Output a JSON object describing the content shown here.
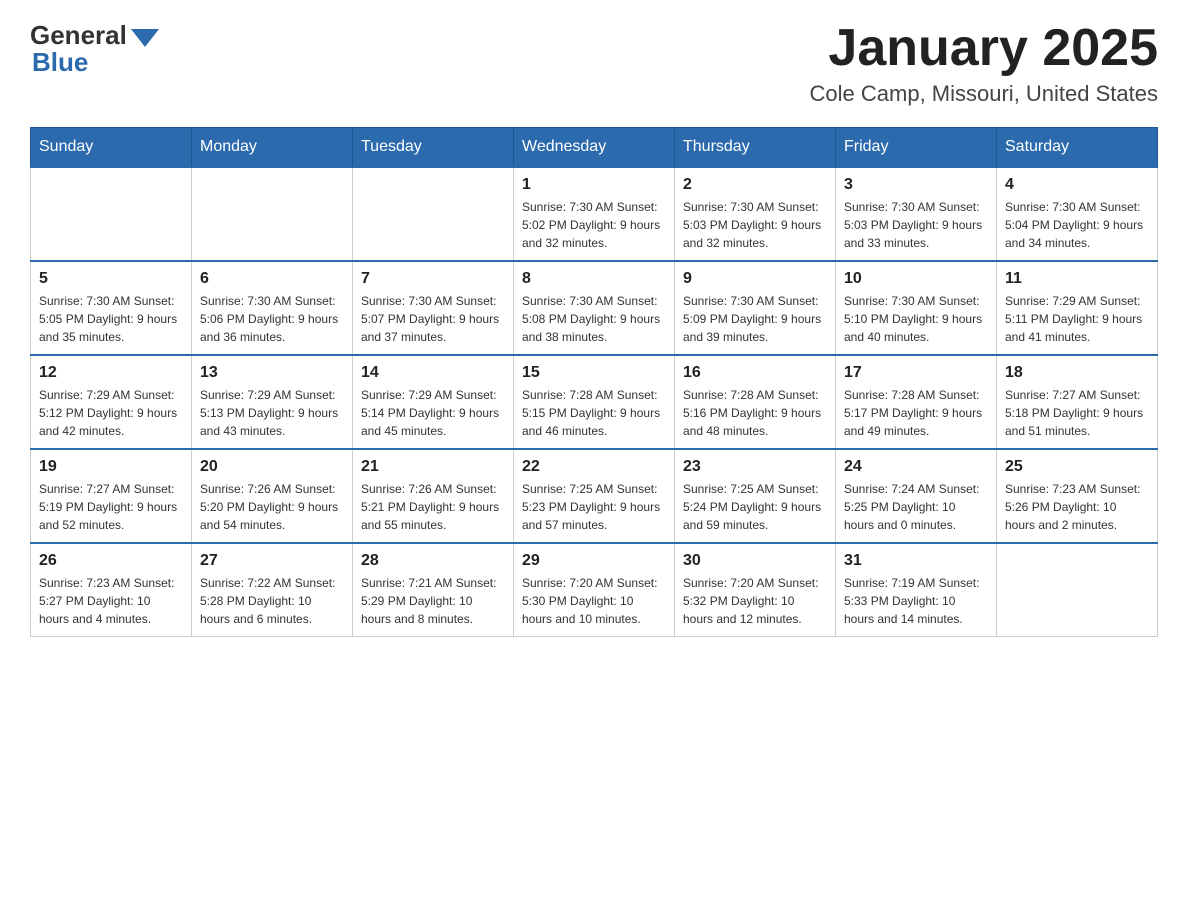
{
  "header": {
    "logo_general": "General",
    "logo_blue": "Blue",
    "month_title": "January 2025",
    "location": "Cole Camp, Missouri, United States"
  },
  "days_of_week": [
    "Sunday",
    "Monday",
    "Tuesday",
    "Wednesday",
    "Thursday",
    "Friday",
    "Saturday"
  ],
  "weeks": [
    [
      {
        "day": "",
        "info": ""
      },
      {
        "day": "",
        "info": ""
      },
      {
        "day": "",
        "info": ""
      },
      {
        "day": "1",
        "info": "Sunrise: 7:30 AM\nSunset: 5:02 PM\nDaylight: 9 hours and 32 minutes."
      },
      {
        "day": "2",
        "info": "Sunrise: 7:30 AM\nSunset: 5:03 PM\nDaylight: 9 hours and 32 minutes."
      },
      {
        "day": "3",
        "info": "Sunrise: 7:30 AM\nSunset: 5:03 PM\nDaylight: 9 hours and 33 minutes."
      },
      {
        "day": "4",
        "info": "Sunrise: 7:30 AM\nSunset: 5:04 PM\nDaylight: 9 hours and 34 minutes."
      }
    ],
    [
      {
        "day": "5",
        "info": "Sunrise: 7:30 AM\nSunset: 5:05 PM\nDaylight: 9 hours and 35 minutes."
      },
      {
        "day": "6",
        "info": "Sunrise: 7:30 AM\nSunset: 5:06 PM\nDaylight: 9 hours and 36 minutes."
      },
      {
        "day": "7",
        "info": "Sunrise: 7:30 AM\nSunset: 5:07 PM\nDaylight: 9 hours and 37 minutes."
      },
      {
        "day": "8",
        "info": "Sunrise: 7:30 AM\nSunset: 5:08 PM\nDaylight: 9 hours and 38 minutes."
      },
      {
        "day": "9",
        "info": "Sunrise: 7:30 AM\nSunset: 5:09 PM\nDaylight: 9 hours and 39 minutes."
      },
      {
        "day": "10",
        "info": "Sunrise: 7:30 AM\nSunset: 5:10 PM\nDaylight: 9 hours and 40 minutes."
      },
      {
        "day": "11",
        "info": "Sunrise: 7:29 AM\nSunset: 5:11 PM\nDaylight: 9 hours and 41 minutes."
      }
    ],
    [
      {
        "day": "12",
        "info": "Sunrise: 7:29 AM\nSunset: 5:12 PM\nDaylight: 9 hours and 42 minutes."
      },
      {
        "day": "13",
        "info": "Sunrise: 7:29 AM\nSunset: 5:13 PM\nDaylight: 9 hours and 43 minutes."
      },
      {
        "day": "14",
        "info": "Sunrise: 7:29 AM\nSunset: 5:14 PM\nDaylight: 9 hours and 45 minutes."
      },
      {
        "day": "15",
        "info": "Sunrise: 7:28 AM\nSunset: 5:15 PM\nDaylight: 9 hours and 46 minutes."
      },
      {
        "day": "16",
        "info": "Sunrise: 7:28 AM\nSunset: 5:16 PM\nDaylight: 9 hours and 48 minutes."
      },
      {
        "day": "17",
        "info": "Sunrise: 7:28 AM\nSunset: 5:17 PM\nDaylight: 9 hours and 49 minutes."
      },
      {
        "day": "18",
        "info": "Sunrise: 7:27 AM\nSunset: 5:18 PM\nDaylight: 9 hours and 51 minutes."
      }
    ],
    [
      {
        "day": "19",
        "info": "Sunrise: 7:27 AM\nSunset: 5:19 PM\nDaylight: 9 hours and 52 minutes."
      },
      {
        "day": "20",
        "info": "Sunrise: 7:26 AM\nSunset: 5:20 PM\nDaylight: 9 hours and 54 minutes."
      },
      {
        "day": "21",
        "info": "Sunrise: 7:26 AM\nSunset: 5:21 PM\nDaylight: 9 hours and 55 minutes."
      },
      {
        "day": "22",
        "info": "Sunrise: 7:25 AM\nSunset: 5:23 PM\nDaylight: 9 hours and 57 minutes."
      },
      {
        "day": "23",
        "info": "Sunrise: 7:25 AM\nSunset: 5:24 PM\nDaylight: 9 hours and 59 minutes."
      },
      {
        "day": "24",
        "info": "Sunrise: 7:24 AM\nSunset: 5:25 PM\nDaylight: 10 hours and 0 minutes."
      },
      {
        "day": "25",
        "info": "Sunrise: 7:23 AM\nSunset: 5:26 PM\nDaylight: 10 hours and 2 minutes."
      }
    ],
    [
      {
        "day": "26",
        "info": "Sunrise: 7:23 AM\nSunset: 5:27 PM\nDaylight: 10 hours and 4 minutes."
      },
      {
        "day": "27",
        "info": "Sunrise: 7:22 AM\nSunset: 5:28 PM\nDaylight: 10 hours and 6 minutes."
      },
      {
        "day": "28",
        "info": "Sunrise: 7:21 AM\nSunset: 5:29 PM\nDaylight: 10 hours and 8 minutes."
      },
      {
        "day": "29",
        "info": "Sunrise: 7:20 AM\nSunset: 5:30 PM\nDaylight: 10 hours and 10 minutes."
      },
      {
        "day": "30",
        "info": "Sunrise: 7:20 AM\nSunset: 5:32 PM\nDaylight: 10 hours and 12 minutes."
      },
      {
        "day": "31",
        "info": "Sunrise: 7:19 AM\nSunset: 5:33 PM\nDaylight: 10 hours and 14 minutes."
      },
      {
        "day": "",
        "info": ""
      }
    ]
  ]
}
